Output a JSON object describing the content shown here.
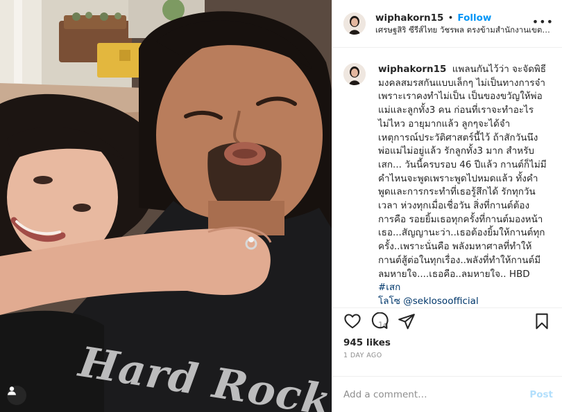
{
  "header": {
    "username": "wiphakorn15",
    "separator": "•",
    "follow_label": "Follow",
    "location": "เศรษฐสิริ ซีรีส์ไทย วัชรพล ตรงข้ามสำนักงานเขตสา..."
  },
  "photo": {
    "shirt_print": "Hard Rock",
    "tag_icon": "user-tag-icon"
  },
  "caption": {
    "username": "wiphakorn15",
    "text": "แพลนกันไว้ว่า จะจัดพิธี\nมงคลสมรสกันแบบเล็กๆ ไม่เป็นทางการจ๋า\nเพราะเราคงทำไม่เป็น เป็นของขวัญให้พ่อ\nแม่และลูกทั้ง3 คน ก่อนที่เราจะทำอะไร\nไม่ไหว อายุมากแล้ว ลูกๆจะได้จำ\nเหตุการณ์ประวัติศาสตร์นี้ไว้ ถ้าสักวันนึง\nพ่อแม่ไม่อยู่แล้ว รักลูกทั้ง3 มาก สำหรับ\nเสก... วันนี้ครบรอบ 46 ปีแล้ว กานต์ก็ไม่มี\nคำไหนจะพูดเพราะพูดไปหมดแล้ว ทั้งคำ\nพูดและการกระทำที่เธอรู้สึกได้ รักทุกวัน\nเวลา ห่วงทุกเมื่อเชื่อวัน สิ่งที่กานต์ต้อง\nการคือ รอยยิ้มเธอทุกครั้งที่กานต์มองหน้า\nเธอ...สัญญานะว่า..เธอต้องยิ้มให้กานต์ทุก\nครั้ง..เพราะนั่นคือ พลังมหาศาลที่ทำให้\nกานต์สู้ต่อในทุกเรื่อง..พลังที่ทำให้กานต์มี\nลมหายใจ....เธอคือ..ลมหายใจ.. HBD ",
    "hashtag": "#เสก\nโลโซ",
    "mention": "@seklosoofficial",
    "time": "1d"
  },
  "actions": {
    "like_icon": "heart-icon",
    "comment_icon": "comment-icon",
    "share_icon": "share-icon",
    "save_icon": "bookmark-icon"
  },
  "likes": "945 likes",
  "posted_ago": "1 DAY AGO",
  "comment_box": {
    "placeholder": "Add a comment…",
    "post_label": "Post"
  },
  "colors": {
    "follow": "#0095f6",
    "mention": "#00376b",
    "post_disabled": "#b2dffc",
    "muted": "#8e8e8e"
  }
}
